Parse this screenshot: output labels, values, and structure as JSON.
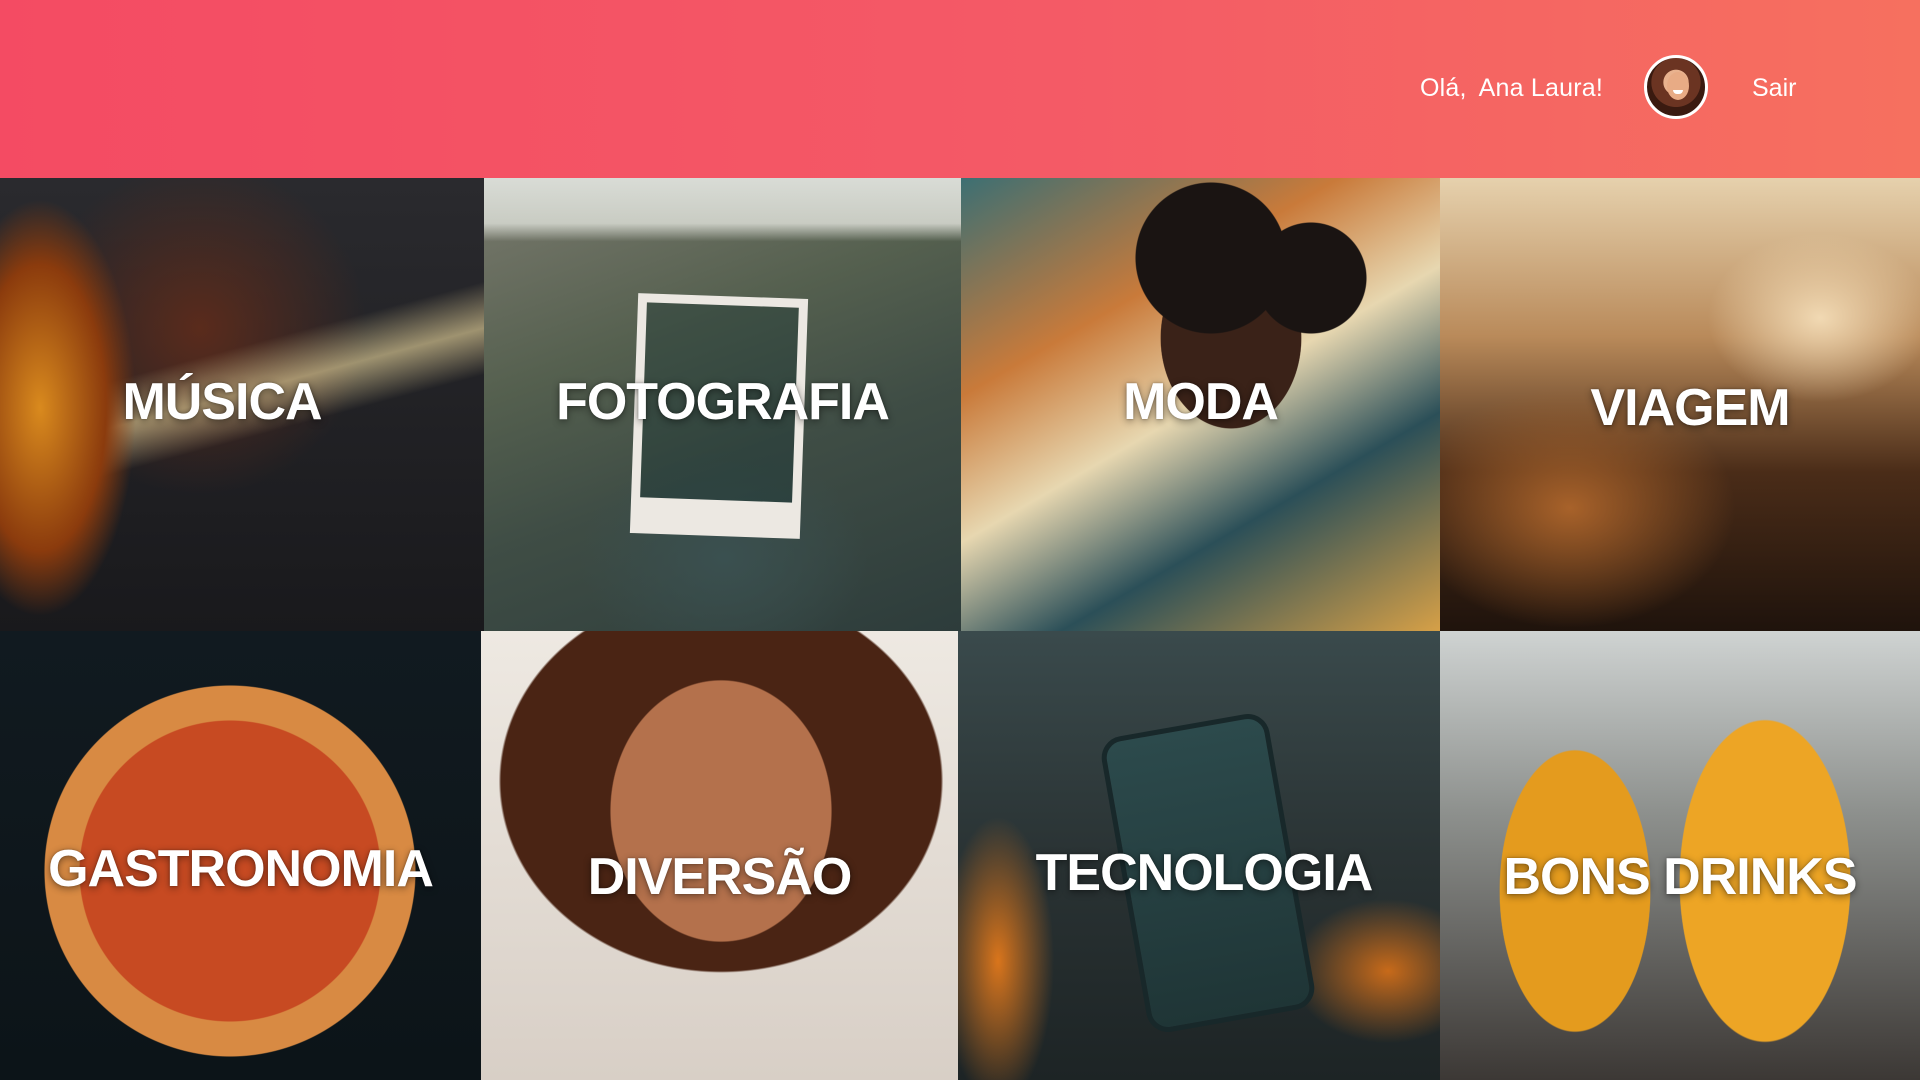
{
  "header": {
    "greeting_prefix": "Olá,",
    "user_name": "Ana Laura!",
    "logout_label": "Sair",
    "gradient_start": "#f44b63",
    "gradient_end": "#f6705f"
  },
  "categories": [
    {
      "label": "MÚSICA"
    },
    {
      "label": "FOTOGRAFIA"
    },
    {
      "label": "MODA"
    },
    {
      "label": "VIAGEM"
    },
    {
      "label": "GASTRONOMIA"
    },
    {
      "label": "DIVERSÃO"
    },
    {
      "label": "TECNOLOGIA"
    },
    {
      "label": "BONS DRINKS"
    }
  ]
}
